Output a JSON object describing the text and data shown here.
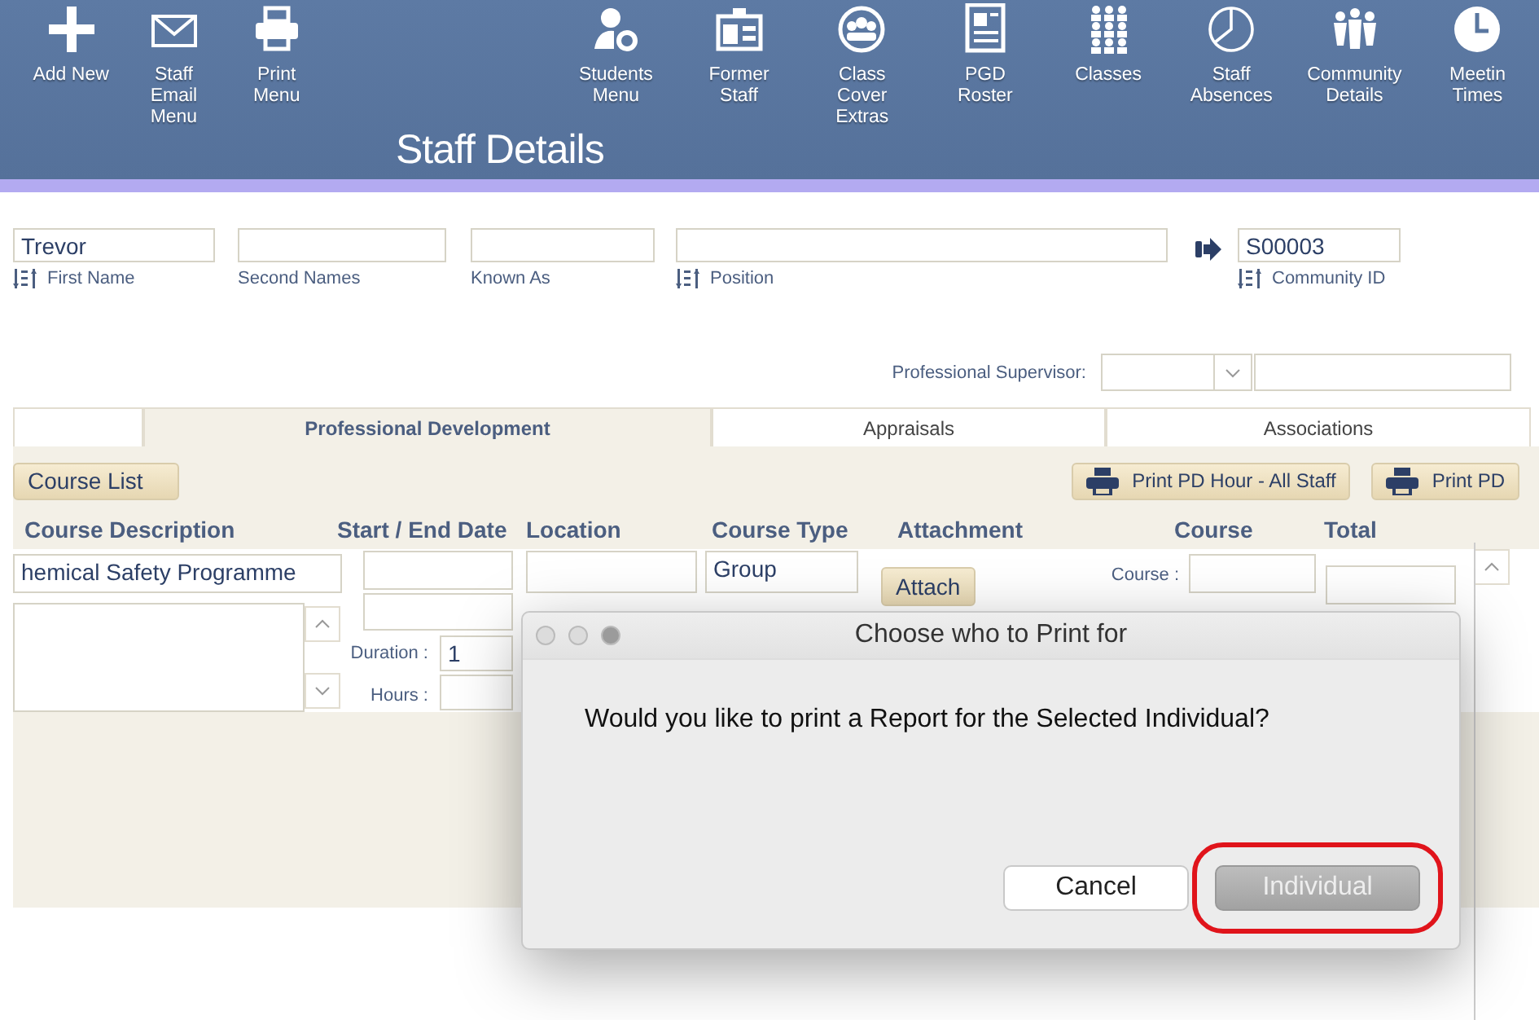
{
  "toolbar": {
    "buttons": [
      {
        "label": "Add New"
      },
      {
        "label": "Staff\nEmail\nMenu"
      },
      {
        "label": "Print\nMenu"
      },
      {
        "label": "Students\nMenu"
      },
      {
        "label": "Former\nStaff"
      },
      {
        "label": "Class\nCover\nExtras"
      },
      {
        "label": "PGD\nRoster"
      },
      {
        "label": "Classes"
      },
      {
        "label": "Staff\nAbsences"
      },
      {
        "label": "Community\nDetails"
      },
      {
        "label": "Meetin\nTimes"
      }
    ],
    "title": "Staff Details"
  },
  "fields": [
    {
      "value": "Trevor",
      "label": "First Name",
      "sortable": true
    },
    {
      "label": "Second Names",
      "sortable": false
    },
    {
      "label": "Known As",
      "sortable": false
    },
    {
      "label": "Position",
      "sortable": true
    }
  ],
  "community": {
    "value": "S00003",
    "label": "Community ID",
    "sortable": true
  },
  "supervisor": {
    "label": "Professional Supervisor:"
  },
  "tabs": [
    {
      "label": "Professional Development",
      "selected": true
    },
    {
      "label": "Appraisals",
      "selected": false
    },
    {
      "label": "Associations",
      "selected": false
    }
  ],
  "course_list_button": "Course List",
  "print_buttons": [
    "Print PD Hour - All Staff",
    "Print PD"
  ],
  "columns": [
    "Course Description",
    "Start / End Date",
    "Location",
    "Course Type",
    "Attachment",
    "Course",
    "Total"
  ],
  "course": {
    "description": "hemical Safety Programme",
    "duration_label": "Duration :",
    "duration": "1",
    "hours_label": "Hours :",
    "course_type": "Group",
    "attach_button": "Attach",
    "course_label": "Course :"
  },
  "dialog": {
    "title": "Choose who to Print for",
    "message": "Would you like to print a Report for the Selected Individual?",
    "buttons": [
      {
        "label": "Cancel",
        "highlighted": false
      },
      {
        "label": "Individual",
        "highlighted": true
      }
    ]
  }
}
